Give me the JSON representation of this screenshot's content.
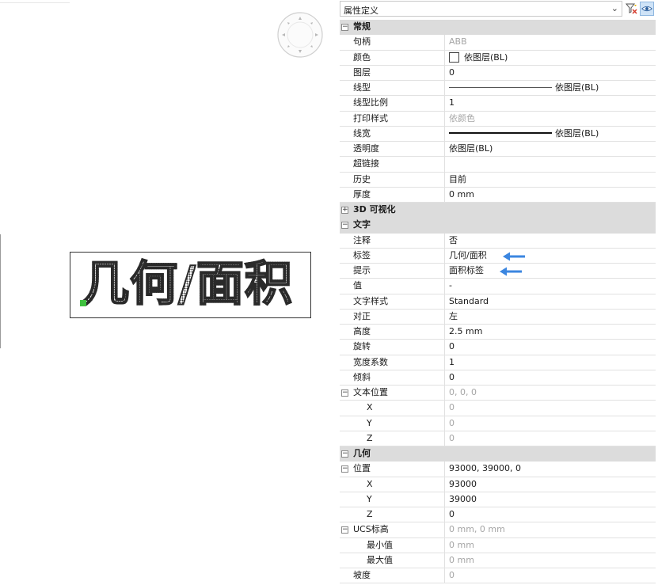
{
  "canvas": {
    "drawing_text": "几何/面积",
    "accent_green": "#3fc13f"
  },
  "panel": {
    "type_select": "属性定义",
    "accent_blue": "#3b86e0"
  },
  "sections": {
    "general": {
      "title": "常规",
      "rows": [
        {
          "name": "句柄",
          "value": "ABB"
        },
        {
          "name": "颜色",
          "value": "依图层(BL)"
        },
        {
          "name": "图层",
          "value": "0"
        },
        {
          "name": "线型",
          "value": "依图层(BL)"
        },
        {
          "name": "线型比例",
          "value": "1"
        },
        {
          "name": "打印样式",
          "value": "依颜色"
        },
        {
          "name": "线宽",
          "value": "依图层(BL)"
        },
        {
          "name": "透明度",
          "value": "依图层(BL)"
        },
        {
          "name": "超链接",
          "value": ""
        },
        {
          "name": "历史",
          "value": "目前"
        },
        {
          "name": "厚度",
          "value": "0 mm"
        }
      ]
    },
    "visual3d": {
      "title": "3D 可视化"
    },
    "text": {
      "title": "文字",
      "rows": [
        {
          "name": "注释",
          "value": "否"
        },
        {
          "name": "标签",
          "value": "几何/面积"
        },
        {
          "name": "提示",
          "value": "面积标签"
        },
        {
          "name": "值",
          "value": "-"
        },
        {
          "name": "文字样式",
          "value": "Standard"
        },
        {
          "name": "对正",
          "value": "左"
        },
        {
          "name": "高度",
          "value": "2.5 mm"
        },
        {
          "name": "旋转",
          "value": "0"
        },
        {
          "name": "宽度系数",
          "value": "1"
        },
        {
          "name": "倾斜",
          "value": "0"
        },
        {
          "name": "文本位置",
          "value": "0, 0, 0"
        },
        {
          "name": "X",
          "value": "0"
        },
        {
          "name": "Y",
          "value": "0"
        },
        {
          "name": "Z",
          "value": "0"
        }
      ]
    },
    "geometry": {
      "title": "几何",
      "rows": [
        {
          "name": "位置",
          "value": "93000, 39000, 0"
        },
        {
          "name": "X",
          "value": "93000"
        },
        {
          "name": "Y",
          "value": "39000"
        },
        {
          "name": "Z",
          "value": "0"
        },
        {
          "name": "UCS标高",
          "value": "0 mm, 0 mm"
        },
        {
          "name": "最小值",
          "value": "0 mm"
        },
        {
          "name": "最大值",
          "value": "0 mm"
        },
        {
          "name": "坡度",
          "value": "0"
        }
      ]
    }
  }
}
